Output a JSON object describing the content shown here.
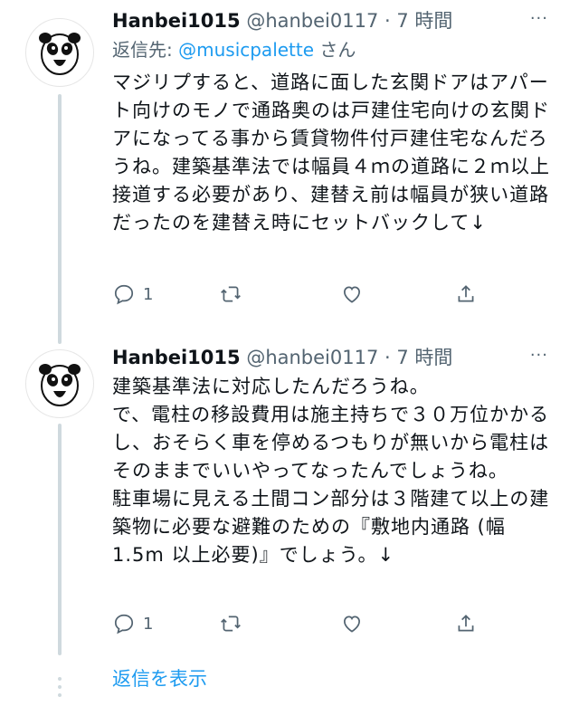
{
  "tweets": [
    {
      "name": "Hanbei1015",
      "handle": "@hanbei0117",
      "separator": "·",
      "time": "7 時間",
      "more": "···",
      "reply_prefix": "返信先: ",
      "reply_mention": "@musicpalette",
      "reply_suffix": " さん",
      "body": "マジリプすると、道路に面した玄関ドアはアパート向けのモノで通路奥のは戸建住宅向けの玄関ドアになってる事から賃貸物件付戸建住宅なんだろうね。建築基準法では幅員４ｍの道路に２ｍ以上接道する必要があり、建替え前は幅員が狭い道路だったのを建替え時にセットバックして↓",
      "reply_count": "1"
    },
    {
      "name": "Hanbei1015",
      "handle": "@hanbei0117",
      "separator": "·",
      "time": "7 時間",
      "more": "···",
      "body": "建築基準法に対応したんだろうね。\nで、電柱の移設費用は施主持ちで３０万位かかるし、おそらく車を停めるつもりが無いから電柱はそのままでいいやってなったんでしょうね。\n駐車場に見える土間コン部分は３階建て以上の建築物に必要な避難のための『敷地内通路 (幅 1.5m 以上必要)』でしょう。↓",
      "reply_count": "1"
    }
  ],
  "show_replies": "返信を表示",
  "colors": {
    "accent": "#1d9bf0",
    "muted": "#536471",
    "text": "#0f1419",
    "thread": "#cfd9de"
  },
  "icons": [
    "panda-avatar",
    "reply-icon",
    "retweet-icon",
    "like-icon",
    "share-icon",
    "more-icon"
  ]
}
